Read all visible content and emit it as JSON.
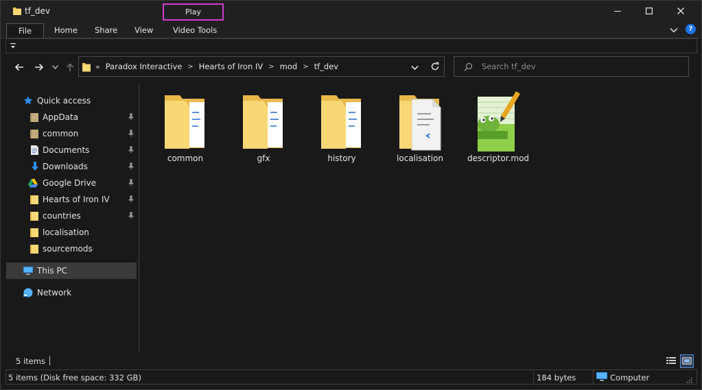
{
  "window": {
    "title": "tf_dev",
    "context_tab": "Play",
    "controls": {
      "minimize": "—",
      "maximize": "□",
      "close": "✕"
    }
  },
  "ribbon": {
    "tabs": [
      "File",
      "Home",
      "Share",
      "View",
      "Video Tools"
    ],
    "help": "?"
  },
  "address": {
    "overflow": "«",
    "separator": ">",
    "crumbs": [
      "Paradox Interactive",
      "Hearts of Iron IV",
      "mod",
      "tf_dev"
    ]
  },
  "search": {
    "placeholder": "Search tf_dev"
  },
  "nav_pane": {
    "quick_access": "Quick access",
    "items": [
      {
        "label": "AppData",
        "icon": "folder-icon",
        "pinned": true
      },
      {
        "label": "common",
        "icon": "folder-icon",
        "pinned": true
      },
      {
        "label": "Documents",
        "icon": "documents-icon",
        "pinned": true
      },
      {
        "label": "Downloads",
        "icon": "download-arrow-icon",
        "pinned": true
      },
      {
        "label": "Google Drive",
        "icon": "google-drive-icon",
        "pinned": true
      },
      {
        "label": "Hearts of Iron IV",
        "icon": "folder-icon",
        "pinned": true
      },
      {
        "label": "countries",
        "icon": "folder-icon",
        "pinned": true
      },
      {
        "label": "localisation",
        "icon": "folder-icon",
        "pinned": false
      },
      {
        "label": "sourcemods",
        "icon": "folder-icon",
        "pinned": false
      }
    ],
    "this_pc": "This PC",
    "network": "Network"
  },
  "files": [
    {
      "name": "common",
      "type": "folder-icon"
    },
    {
      "name": "gfx",
      "type": "folder-icon"
    },
    {
      "name": "history",
      "type": "folder-icon"
    },
    {
      "name": "localisation",
      "type": "folder-vscode-icon"
    },
    {
      "name": "descriptor.mod",
      "type": "notepad-plus-plus-icon"
    }
  ],
  "status": {
    "item_count": "5 items",
    "details": "5 items (Disk free space: 332 GB)",
    "size": "184 bytes",
    "location": "Computer"
  },
  "colors": {
    "accent": "#1a73e8",
    "folder": "#f3c65a",
    "highlight": "#d63bd6"
  }
}
